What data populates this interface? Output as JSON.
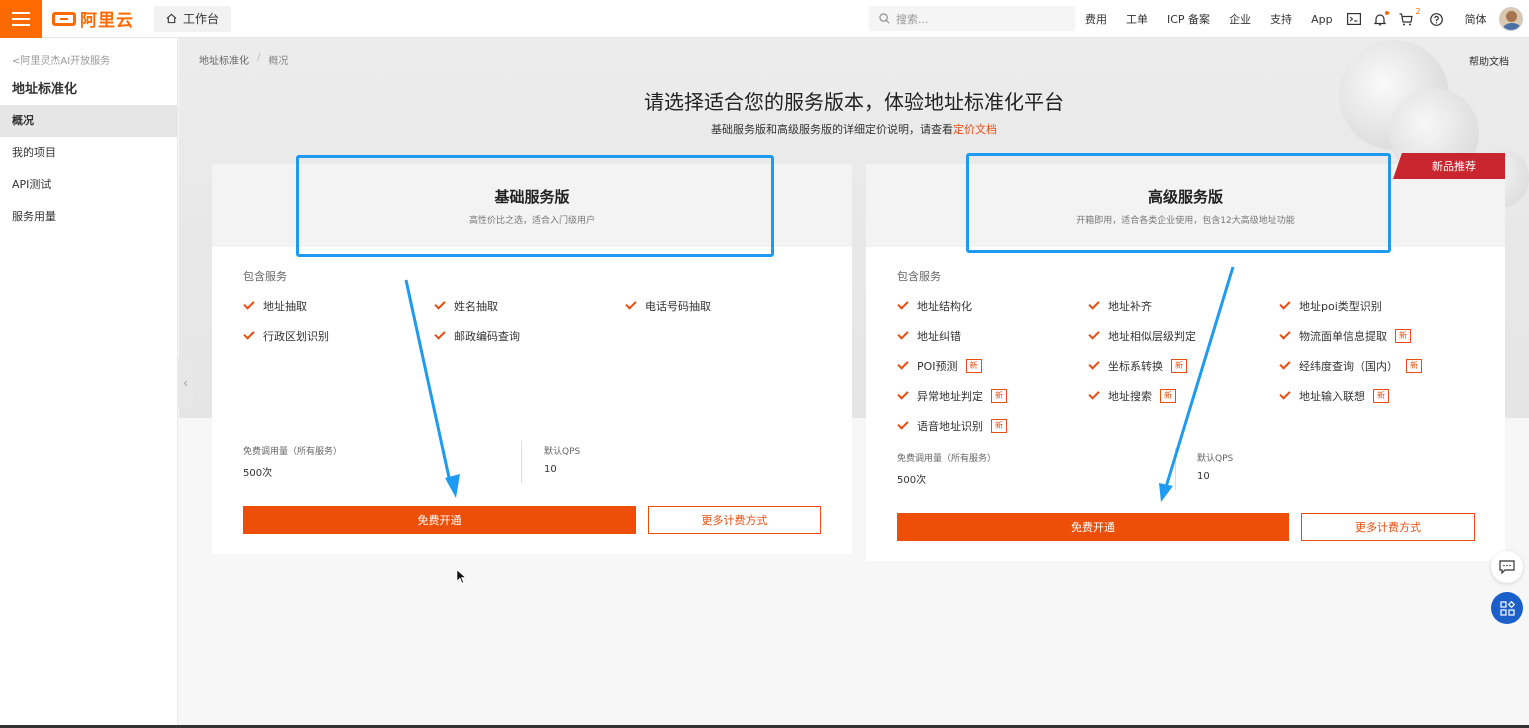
{
  "topbar": {
    "logo_text": "阿里云",
    "workbench": "工作台",
    "search_placeholder": "搜索...",
    "nav": [
      "费用",
      "工单",
      "ICP 备案",
      "企业",
      "支持",
      "App"
    ],
    "cart_count": "2",
    "language": "简体"
  },
  "sidebar": {
    "back": "阿里灵杰AI开放服务",
    "title": "地址标准化",
    "items": [
      "概况",
      "我的项目",
      "API测试",
      "服务用量"
    ],
    "active": "概况"
  },
  "breadcrumb": [
    "地址标准化",
    "概况"
  ],
  "help_doc": "帮助文档",
  "hero": {
    "title": "请选择适合您的服务版本，体验地址标准化平台",
    "subtitle": "基础服务版和高级服务版的详细定价说明，请查看",
    "subtitle_link": "定价文档"
  },
  "basic": {
    "name": "基础服务版",
    "desc": "高性价比之选，适合入门级用户",
    "includes_label": "包含服务",
    "features": [
      "地址抽取",
      "姓名抽取",
      "电话号码抽取",
      "行政区划识别",
      "邮政编码查询"
    ],
    "quota_label": "免费调用量（所有服务）",
    "quota_value": "500次",
    "qps_label": "默认QPS",
    "qps_value": "10",
    "primary_btn": "免费开通",
    "secondary_btn": "更多计费方式"
  },
  "advanced": {
    "ribbon": "新品推荐",
    "name": "高级服务版",
    "desc": "开箱即用，适合各类企业使用，包含12大高级地址功能",
    "includes_label": "包含服务",
    "features": [
      "地址结构化",
      "地址补齐",
      "地址poi类型识别",
      "地址纠错",
      "地址相似层级判定",
      "物流面单信息提取",
      "POI预测",
      "坐标系转换",
      "经纬度查询（国内）",
      "异常地址判定",
      "地址搜索",
      "地址输入联想",
      "语音地址识别"
    ],
    "new_tag": "新",
    "quota_label": "免费调用量（所有服务）",
    "quota_value": "500次",
    "qps_label": "默认QPS",
    "qps_value": "10",
    "primary_btn": "免费开通",
    "secondary_btn": "更多计费方式"
  },
  "colors": {
    "brand": "#ff6a00",
    "primary_button": "#ed4e08",
    "ribbon": "#c9252e",
    "annotation": "#1e9bf0"
  }
}
